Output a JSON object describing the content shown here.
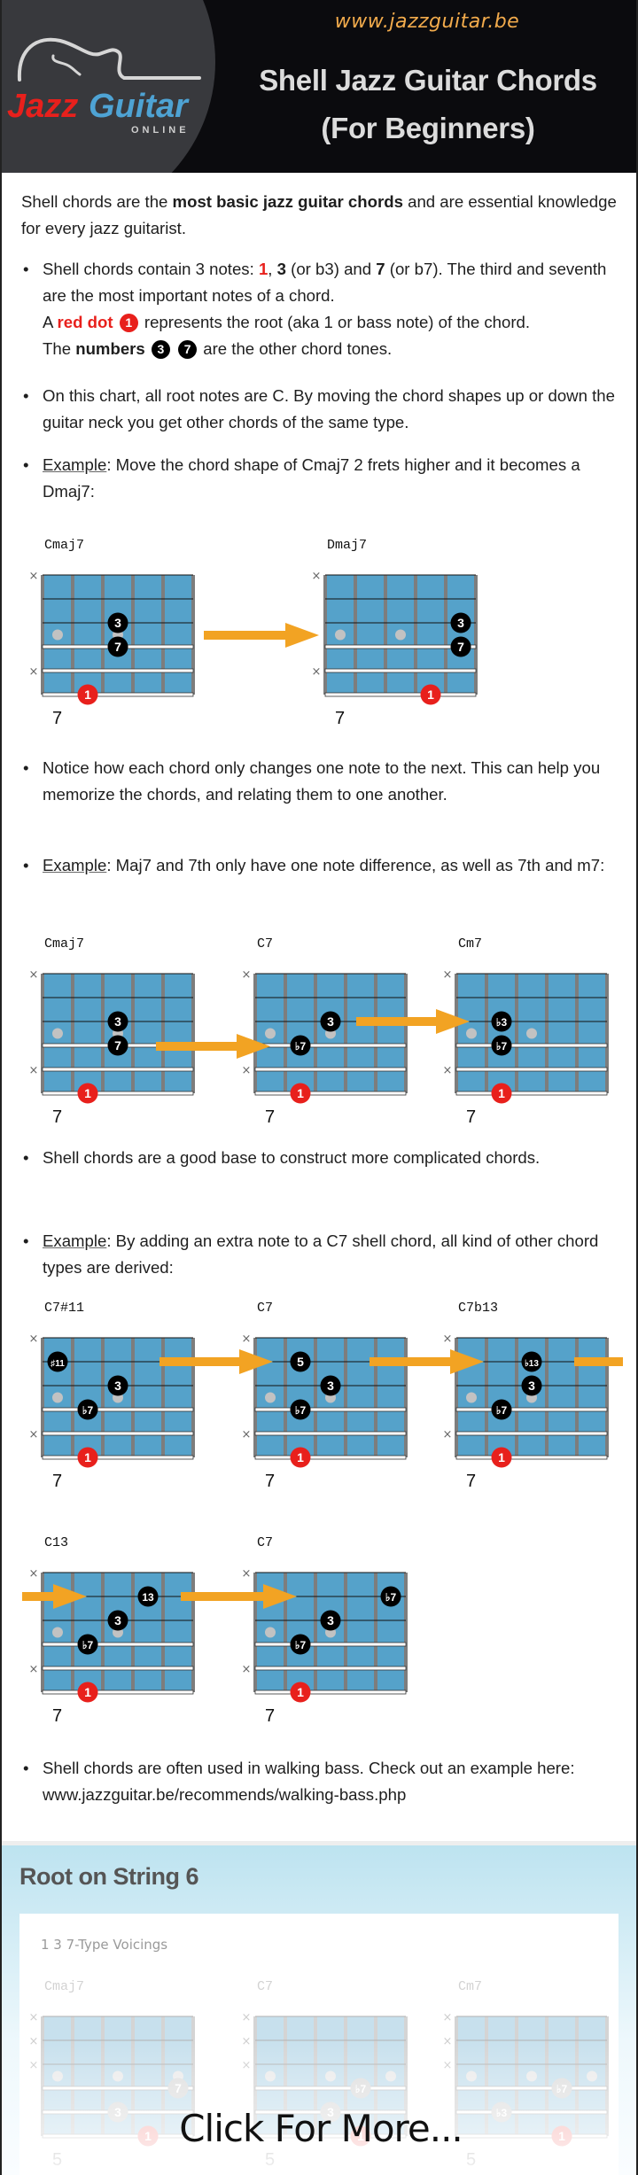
{
  "header": {
    "site_url": "www.jazzguitar.be",
    "title_line1": "Shell Jazz Guitar Chords",
    "title_line2": "(For Beginners)",
    "logo": {
      "word1": "Jazz",
      "word2": "Guitar",
      "tagline": "ONLINE"
    },
    "colors": {
      "url": "#f2ab4c",
      "logo_red": "#e8201c",
      "logo_blue": "#4ea3d4"
    }
  },
  "intro": {
    "pre": "Shell chords are the ",
    "bold": "most basic jazz guitar chords",
    "post": " and are essential knowledge for every jazz guitarist."
  },
  "bullet1": {
    "a": "Shell chords contain 3 notes: ",
    "n1": "1",
    "c1": ", ",
    "n3": "3",
    "b": " (or b3) and ",
    "n7": "7",
    "c": " (or b7). The third and seventh are the most important notes of a chord.",
    "d": "A ",
    "red_dot": "red dot",
    "dot1": "1",
    "e": " represents the root (aka 1 or bass note) of the chord.",
    "f": "The ",
    "numbers": "numbers",
    "dot3": "3",
    "dot7": "7",
    "g": " are the other chord tones."
  },
  "bullet2": {
    "text": "On this chart, all root notes are C. By moving the chord shapes up or down the guitar neck you get other chords of the same type."
  },
  "example1": {
    "label": "Example",
    "text": ": Move the chord shape of Cmaj7 2 frets higher and it becomes a Dmaj7:"
  },
  "bullet3": {
    "text": "Notice how each chord only changes one note to the next. This can help you memorize the chords, and relating them to one another."
  },
  "example2": {
    "label": "Example",
    "text": ": Maj7 and 7th only have one note difference, as well as 7th and m7:"
  },
  "bullet4": {
    "text": "Shell chords are a good base to construct more complicated chords."
  },
  "example3": {
    "label": "Example",
    "text": ": By adding an extra note to a C7 shell chord, all kind of other chord types are derived:"
  },
  "bullet5": {
    "text": "Shell chords are often used in walking bass. Check out an example here: www.jazzguitar.be/recommends/walking-bass.php"
  },
  "section": {
    "title": "Root on String 6",
    "subtitle": "1 3 7-Type Voicings",
    "cta": "Click For More..."
  },
  "colors": {
    "fretboard": "#55a2ca",
    "fret": "#7d7d7d",
    "root": "#e8201c",
    "tone": "#000000",
    "marker": "#c2c2c2",
    "arrow": "#f2a323"
  },
  "diagrams": [
    {
      "name": "Cmaj7",
      "fret": "7",
      "muted": [
        1,
        5
      ],
      "dots": [
        {
          "s": 3,
          "c": 3,
          "t": "3"
        },
        {
          "s": 4,
          "c": 3,
          "t": "7"
        },
        {
          "s": 6,
          "c": 2,
          "t": "1",
          "root": true
        }
      ]
    },
    {
      "name": "Dmaj7",
      "fret": "7",
      "muted": [
        1,
        5
      ],
      "dots": [
        {
          "s": 3,
          "c": 5,
          "t": "3"
        },
        {
          "s": 4,
          "c": 5,
          "t": "7"
        },
        {
          "s": 6,
          "c": 4,
          "t": "1",
          "root": true
        }
      ]
    },
    {
      "name": "Cmaj7",
      "fret": "7",
      "muted": [
        1,
        5
      ],
      "dots": [
        {
          "s": 3,
          "c": 3,
          "t": "3"
        },
        {
          "s": 4,
          "c": 3,
          "t": "7"
        },
        {
          "s": 6,
          "c": 2,
          "t": "1",
          "root": true
        }
      ]
    },
    {
      "name": "C7",
      "fret": "7",
      "muted": [
        1,
        5
      ],
      "dots": [
        {
          "s": 3,
          "c": 3,
          "t": "3"
        },
        {
          "s": 4,
          "c": 2,
          "t": "♭7"
        },
        {
          "s": 6,
          "c": 2,
          "t": "1",
          "root": true
        }
      ]
    },
    {
      "name": "Cm7",
      "fret": "7",
      "muted": [
        1,
        5
      ],
      "dots": [
        {
          "s": 3,
          "c": 2,
          "t": "♭3"
        },
        {
          "s": 4,
          "c": 2,
          "t": "♭7"
        },
        {
          "s": 6,
          "c": 2,
          "t": "1",
          "root": true
        }
      ]
    },
    {
      "name": "C7#11",
      "fret": "7",
      "muted": [
        1,
        5
      ],
      "dots": [
        {
          "s": 2,
          "c": 1,
          "t": "♯11"
        },
        {
          "s": 3,
          "c": 3,
          "t": "3"
        },
        {
          "s": 4,
          "c": 2,
          "t": "♭7"
        },
        {
          "s": 6,
          "c": 2,
          "t": "1",
          "root": true
        }
      ]
    },
    {
      "name": "C7",
      "fret": "7",
      "muted": [
        1,
        5
      ],
      "dots": [
        {
          "s": 2,
          "c": 2,
          "t": "5"
        },
        {
          "s": 3,
          "c": 3,
          "t": "3"
        },
        {
          "s": 4,
          "c": 2,
          "t": "♭7"
        },
        {
          "s": 6,
          "c": 2,
          "t": "1",
          "root": true
        }
      ]
    },
    {
      "name": "C7b13",
      "fret": "7",
      "muted": [
        1,
        5
      ],
      "dots": [
        {
          "s": 2,
          "c": 3,
          "t": "♭13"
        },
        {
          "s": 3,
          "c": 3,
          "t": "3"
        },
        {
          "s": 4,
          "c": 2,
          "t": "♭7"
        },
        {
          "s": 6,
          "c": 2,
          "t": "1",
          "root": true
        }
      ]
    },
    {
      "name": "C13",
      "fret": "7",
      "muted": [
        1,
        5
      ],
      "dots": [
        {
          "s": 2,
          "c": 4,
          "t": "13"
        },
        {
          "s": 3,
          "c": 3,
          "t": "3"
        },
        {
          "s": 4,
          "c": 2,
          "t": "♭7"
        },
        {
          "s": 6,
          "c": 2,
          "t": "1",
          "root": true
        }
      ]
    },
    {
      "name": "C7",
      "fret": "7",
      "muted": [
        1,
        5
      ],
      "dots": [
        {
          "s": 2,
          "c": 5,
          "t": "♭7"
        },
        {
          "s": 3,
          "c": 3,
          "t": "3"
        },
        {
          "s": 4,
          "c": 2,
          "t": "♭7"
        },
        {
          "s": 6,
          "c": 2,
          "t": "1",
          "root": true
        }
      ]
    },
    {
      "name": "Cmaj7",
      "fret": "5",
      "muted": [
        1,
        2,
        3
      ],
      "faded": true,
      "dots": [
        {
          "s": 4,
          "c": 5,
          "t": "7"
        },
        {
          "s": 5,
          "c": 3,
          "t": "3"
        },
        {
          "s": 6,
          "c": 4,
          "t": "1",
          "root": true
        }
      ]
    },
    {
      "name": "C7",
      "fret": "5",
      "muted": [
        1,
        2,
        3
      ],
      "faded": true,
      "dots": [
        {
          "s": 4,
          "c": 4,
          "t": "♭7"
        },
        {
          "s": 5,
          "c": 3,
          "t": "3"
        },
        {
          "s": 6,
          "c": 4,
          "t": "1",
          "root": true
        }
      ]
    },
    {
      "name": "Cm7",
      "fret": "5",
      "muted": [
        1,
        2,
        3
      ],
      "faded": true,
      "dots": [
        {
          "s": 4,
          "c": 4,
          "t": "♭7"
        },
        {
          "s": 5,
          "c": 2,
          "t": "♭3"
        },
        {
          "s": 6,
          "c": 4,
          "t": "1",
          "root": true
        }
      ]
    }
  ]
}
